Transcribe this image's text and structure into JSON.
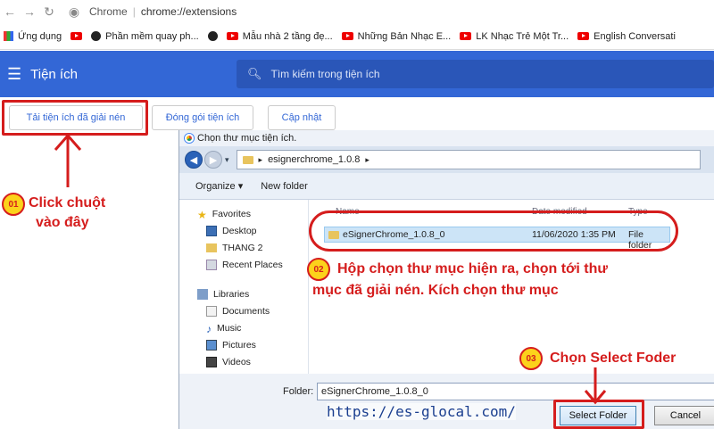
{
  "browser": {
    "chip": "Chrome",
    "url": "chrome://extensions"
  },
  "bookmarks": [
    "Ứng dụng",
    "Phần mềm quay ph...",
    "Mẫu nhà 2 tầng đẹ...",
    "Những Bản Nhạc E...",
    "LK Nhạc Trẻ Một Tr...",
    "English Conversati"
  ],
  "header": {
    "title": "Tiện ích",
    "search_placeholder": "Tìm kiếm trong tiện ích"
  },
  "toolbar": {
    "load_unpacked": "Tải tiện ích đã giải nén",
    "pack": "Đóng gói tiện ích",
    "update": "Cập nhật"
  },
  "dialog": {
    "title": "Chọn thư mục tiện ích.",
    "path_segment": "esignerchrome_1.0.8",
    "organize": "Organize ▾",
    "new_folder": "New folder",
    "nav": {
      "favorites": "Favorites",
      "desktop": "Desktop",
      "thang2": "THANG 2",
      "recent_places": "Recent Places",
      "libraries": "Libraries",
      "documents": "Documents",
      "music": "Music",
      "pictures": "Pictures",
      "videos": "Videos"
    },
    "columns": {
      "name": "Name",
      "date_modified": "Date modified",
      "type": "Type"
    },
    "row": {
      "name": "eSignerChrome_1.0.8_0",
      "date": "11/06/2020 1:35 PM",
      "type": "File folder"
    },
    "folder_label": "Folder:",
    "folder_value": "eSignerChrome_1.0.8_0",
    "select_button": "Select Folder",
    "cancel_button": "Cancel"
  },
  "annotations": {
    "step1_badge": "01",
    "step1_line1": "Click chuột",
    "step1_line2": "vào đây",
    "step2_badge": "02",
    "step2_line1": "Hộp chọn thư mục hiện ra, chọn tới thư",
    "step2_line2": "mục đã giải nén. Kích chọn thư mục",
    "step3_badge": "03",
    "step3_text": "Chọn Select Foder",
    "watermark": "https://es-glocal.com/"
  },
  "colors": {
    "header_blue": "#3367d6",
    "annotation_red": "#d51d1d",
    "badge_yellow": "#fcd21b"
  }
}
